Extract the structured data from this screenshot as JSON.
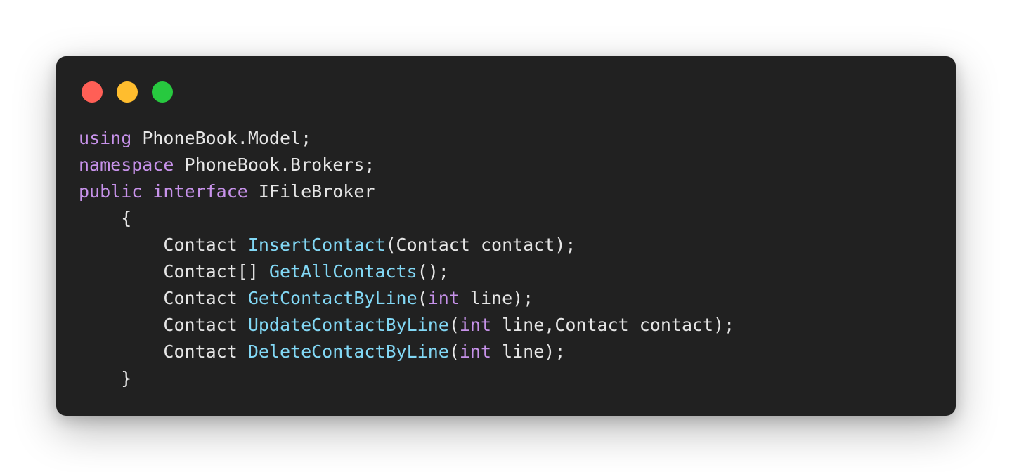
{
  "window": {
    "controls": [
      {
        "name": "close",
        "color": "#ff5f56"
      },
      {
        "name": "minimize",
        "color": "#ffbd2e"
      },
      {
        "name": "maximize",
        "color": "#27c93f"
      }
    ]
  },
  "code": {
    "lines": [
      [
        {
          "t": "kw",
          "v": "using"
        },
        {
          "t": "pl",
          "v": " PhoneBook.Model;"
        }
      ],
      [
        {
          "t": "kw",
          "v": "namespace"
        },
        {
          "t": "pl",
          "v": " PhoneBook.Brokers;"
        }
      ],
      [
        {
          "t": "kw",
          "v": "public"
        },
        {
          "t": "pl",
          "v": " "
        },
        {
          "t": "kw",
          "v": "interface"
        },
        {
          "t": "pl",
          "v": " IFileBroker"
        }
      ],
      [
        {
          "t": "pl",
          "v": "    {"
        }
      ],
      [
        {
          "t": "pl",
          "v": "        Contact "
        },
        {
          "t": "fn",
          "v": "InsertContact"
        },
        {
          "t": "pl",
          "v": "(Contact contact);"
        }
      ],
      [
        {
          "t": "pl",
          "v": "        Contact[] "
        },
        {
          "t": "fn",
          "v": "GetAllContacts"
        },
        {
          "t": "pl",
          "v": "();"
        }
      ],
      [
        {
          "t": "pl",
          "v": "        Contact "
        },
        {
          "t": "fn",
          "v": "GetContactByLine"
        },
        {
          "t": "pl",
          "v": "("
        },
        {
          "t": "kw",
          "v": "int"
        },
        {
          "t": "pl",
          "v": " line);"
        }
      ],
      [
        {
          "t": "pl",
          "v": "        Contact "
        },
        {
          "t": "fn",
          "v": "UpdateContactByLine"
        },
        {
          "t": "pl",
          "v": "("
        },
        {
          "t": "kw",
          "v": "int"
        },
        {
          "t": "pl",
          "v": " line,Contact contact);"
        }
      ],
      [
        {
          "t": "pl",
          "v": "        Contact "
        },
        {
          "t": "fn",
          "v": "DeleteContactByLine"
        },
        {
          "t": "pl",
          "v": "("
        },
        {
          "t": "kw",
          "v": "int"
        },
        {
          "t": "pl",
          "v": " line);"
        }
      ],
      [
        {
          "t": "pl",
          "v": "    }"
        }
      ]
    ]
  }
}
